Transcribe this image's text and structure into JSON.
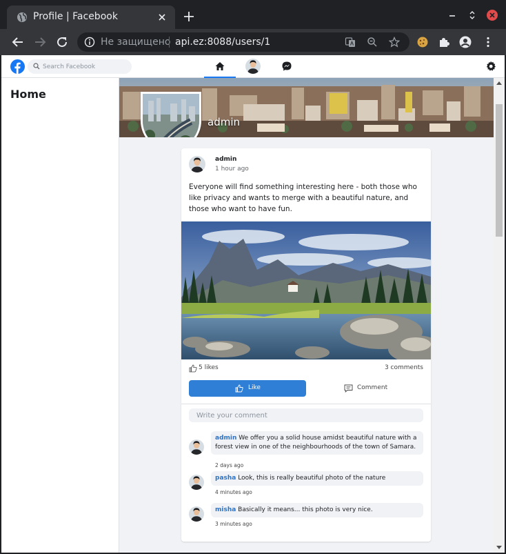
{
  "browser": {
    "tab_title": "Profile | Facebook",
    "security_label": "Не защищено",
    "url": "api.ez:8088/users/1",
    "colors": {
      "frame": "#202124",
      "toolbar": "#35363a",
      "close_button": "#e24b4b"
    }
  },
  "facebook": {
    "search_placeholder": "Search Facebook",
    "nav_items": [
      "home-icon",
      "profile-avatar",
      "messenger-icon"
    ],
    "settings_icon": "gear-icon",
    "brand_color": "#1877f2"
  },
  "sidebar": {
    "title": "Home"
  },
  "profile": {
    "name": "admin"
  },
  "post": {
    "author": "admin",
    "time": "1 hour ago",
    "text": "Everyone will find something interesting here - both those who like privacy and wants to merge with a beautiful nature, and those who want to have fun.",
    "likes": "5 likes",
    "comments_count": "3 comments",
    "like_label": "Like",
    "comment_label": "Comment",
    "comment_placeholder": "Write your comment",
    "like_button_color": "#2f7fd6"
  },
  "comments": [
    {
      "author": "admin",
      "text": " We offer you a solid house amidst beautiful nature with a forest view in one of the neighbourhoods of the town of Samara.",
      "time": "2 days ago"
    },
    {
      "author": "pasha",
      "text": " Look, this is really beautiful photo of the nature",
      "time": "4 minutes ago"
    },
    {
      "author": "misha",
      "text": " Basically it means... this photo is very nice.",
      "time": "3 minutes ago"
    }
  ]
}
